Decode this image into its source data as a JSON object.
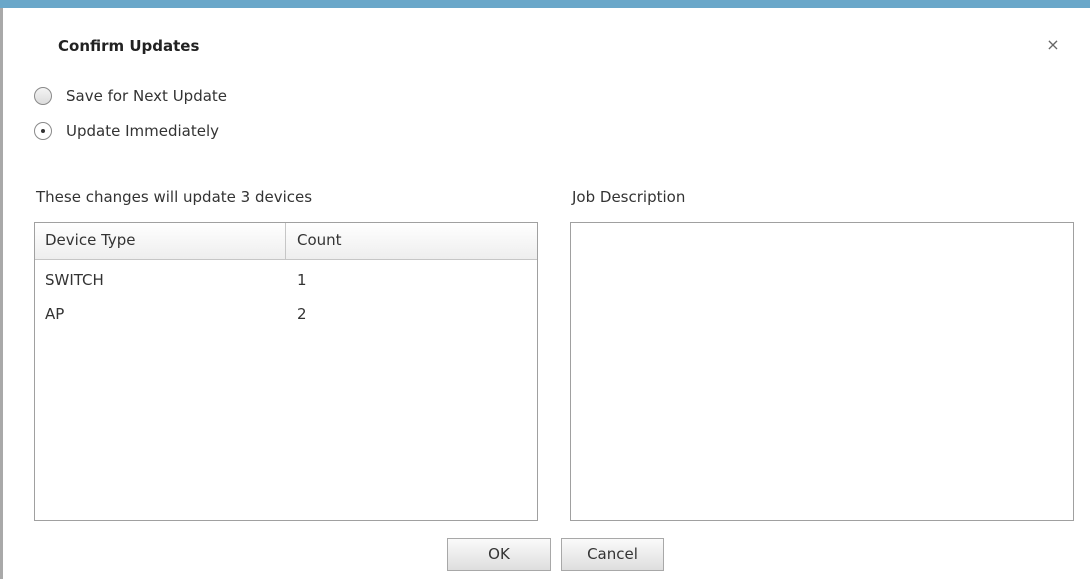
{
  "dialog": {
    "title": "Confirm Updates",
    "close_symbol": "×"
  },
  "options": [
    {
      "label": "Save for Next Update",
      "selected": false
    },
    {
      "label": "Update Immediately",
      "selected": true
    }
  ],
  "devices": {
    "summary": "These changes will update 3 devices",
    "columns": [
      "Device Type",
      "Count"
    ],
    "rows": [
      {
        "type": "SWITCH",
        "count": "1"
      },
      {
        "type": "AP",
        "count": "2"
      }
    ]
  },
  "job_description": {
    "label": "Job Description",
    "value": ""
  },
  "buttons": {
    "ok": "OK",
    "cancel": "Cancel"
  },
  "colors": {
    "header_accent": "#6aa7c9"
  }
}
